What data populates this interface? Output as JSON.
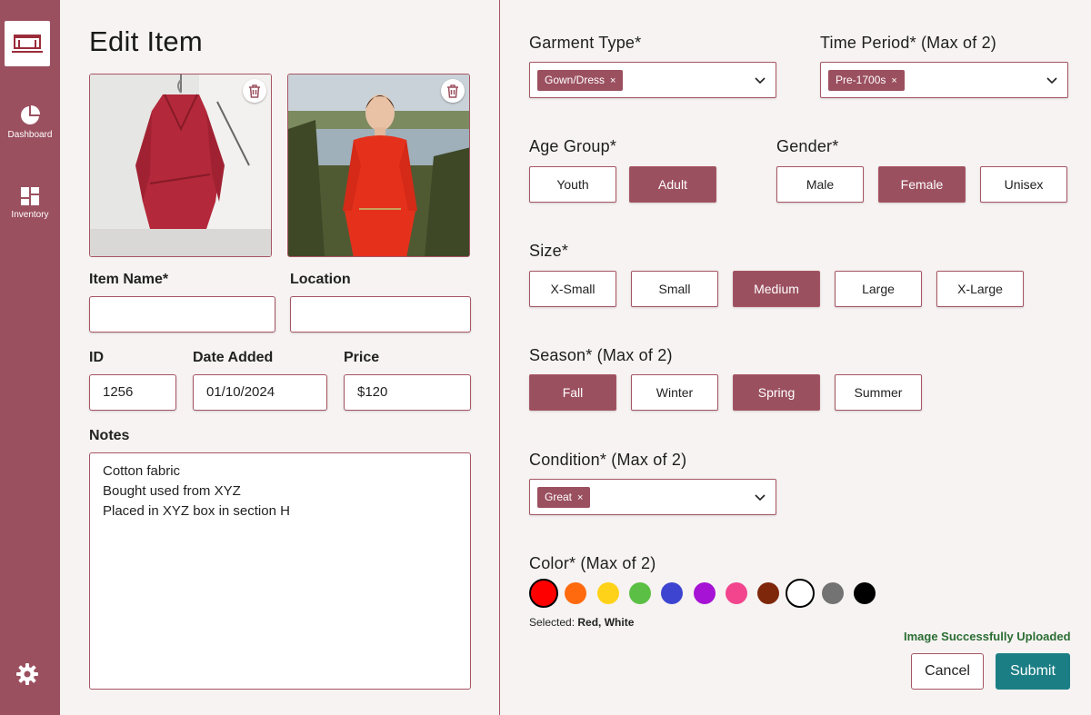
{
  "nav": {
    "dashboard_label": "Dashboard",
    "inventory_label": "Inventory"
  },
  "page": {
    "title": "Edit Item"
  },
  "form": {
    "item_name": {
      "label": "Item Name*",
      "value": ""
    },
    "location": {
      "label": "Location",
      "value": ""
    },
    "id": {
      "label": "ID",
      "value": "1256"
    },
    "date_added": {
      "label": "Date Added",
      "value": "01/10/2024"
    },
    "price": {
      "label": "Price",
      "value": "$120"
    },
    "notes": {
      "label": "Notes",
      "lines": [
        "Cotton fabric",
        "Bought used from XYZ",
        "Placed in XYZ box in section H"
      ]
    }
  },
  "garment_type": {
    "label": "Garment Type*",
    "chip": "Gown/Dress",
    "chip_x": "×"
  },
  "time_period": {
    "label": "Time Period*",
    "note": "(Max of 2)",
    "chip": "Pre-1700s",
    "chip_x": "×"
  },
  "age_group": {
    "label": "Age Group*",
    "options": [
      {
        "label": "Youth",
        "selected": false
      },
      {
        "label": "Adult",
        "selected": true
      }
    ]
  },
  "gender": {
    "label": "Gender*",
    "options": [
      {
        "label": "Male",
        "selected": false
      },
      {
        "label": "Female",
        "selected": true
      },
      {
        "label": "Unisex",
        "selected": false
      }
    ]
  },
  "size": {
    "label": "Size*",
    "options": [
      {
        "label": "X-Small",
        "selected": false
      },
      {
        "label": "Small",
        "selected": false
      },
      {
        "label": "Medium",
        "selected": true
      },
      {
        "label": "Large",
        "selected": false
      },
      {
        "label": "X-Large",
        "selected": false
      }
    ]
  },
  "season": {
    "label": "Season*",
    "note": "(Max of 2)",
    "options": [
      {
        "label": "Fall",
        "selected": true
      },
      {
        "label": "Winter",
        "selected": false
      },
      {
        "label": "Spring",
        "selected": true
      },
      {
        "label": "Summer",
        "selected": false
      }
    ]
  },
  "condition": {
    "label": "Condition*",
    "note": "(Max of 2)",
    "chip": "Great",
    "chip_x": "×"
  },
  "color": {
    "label": "Color*",
    "note": "(Max of 2)",
    "swatches": [
      {
        "name": "red",
        "hex": "#ff0000",
        "selected": true
      },
      {
        "name": "orange",
        "hex": "#ff6a0f",
        "selected": false
      },
      {
        "name": "yellow",
        "hex": "#ffd21a",
        "selected": false
      },
      {
        "name": "green",
        "hex": "#5cbf45",
        "selected": false
      },
      {
        "name": "blue",
        "hex": "#3d45d0",
        "selected": false
      },
      {
        "name": "purple",
        "hex": "#a613d4",
        "selected": false
      },
      {
        "name": "pink",
        "hex": "#f2458e",
        "selected": false
      },
      {
        "name": "brown",
        "hex": "#7f270b",
        "selected": false
      },
      {
        "name": "white",
        "hex": "#ffffff",
        "selected": true
      },
      {
        "name": "gray",
        "hex": "#737373",
        "selected": false
      },
      {
        "name": "black",
        "hex": "#000000",
        "selected": false
      }
    ],
    "selected_prefix": "Selected:",
    "selected_value": "Red, White"
  },
  "status": {
    "message": "Image Successfully Uploaded"
  },
  "actions": {
    "cancel_label": "Cancel",
    "submit_label": "Submit"
  },
  "theme": {
    "accent": "#9b505f",
    "submit": "#1c7e85",
    "status": "#2b6d33"
  }
}
